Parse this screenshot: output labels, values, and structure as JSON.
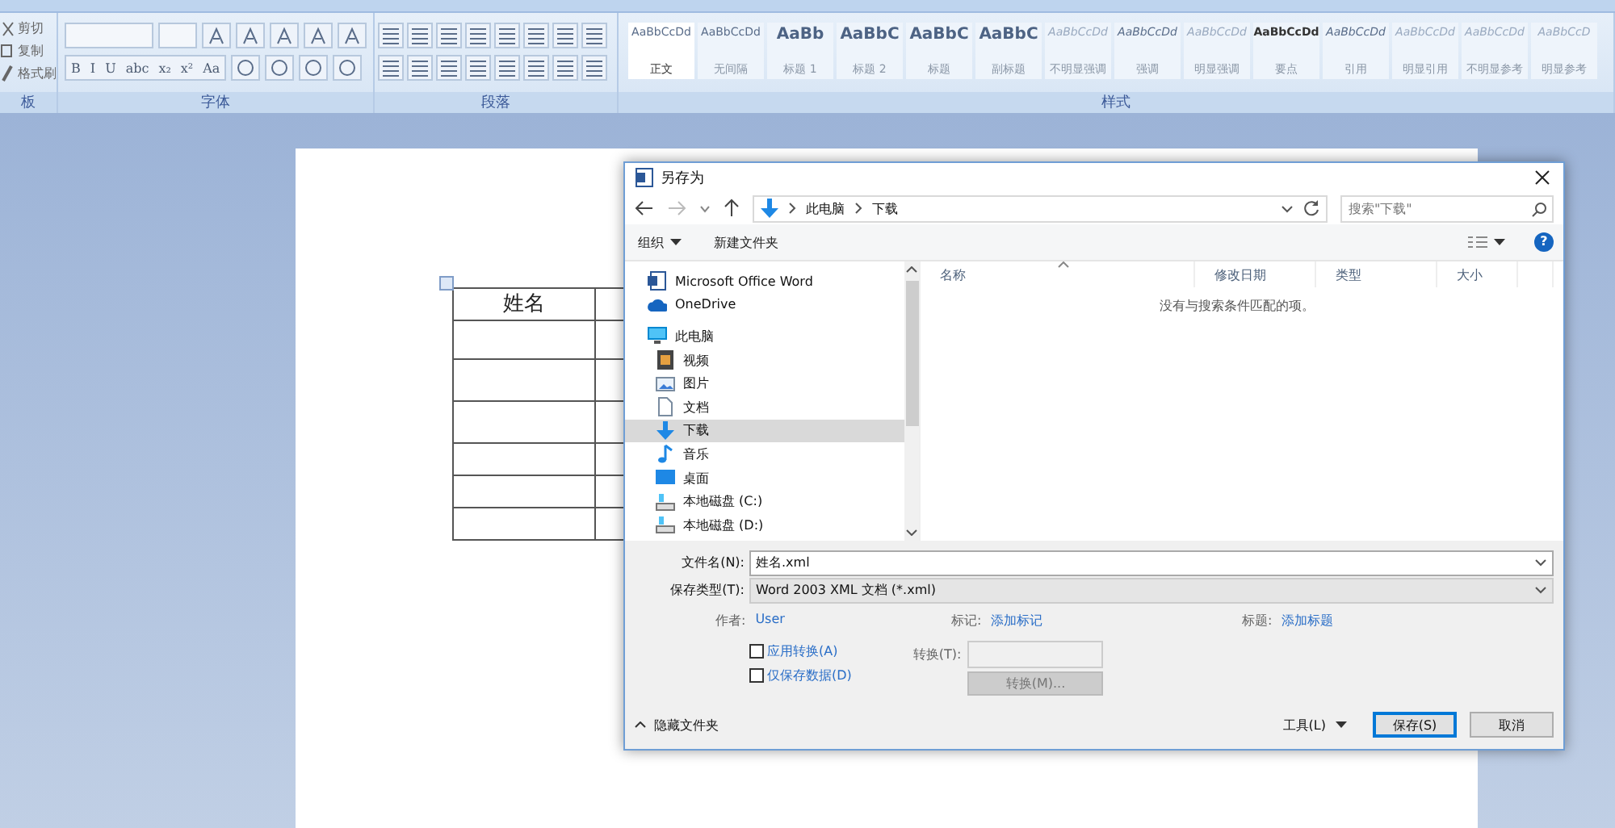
{
  "ribbon": {
    "clipboard": {
      "items": [
        {
          "kind": "cut",
          "label": "剪切"
        },
        {
          "kind": "copy",
          "label": "复制"
        },
        {
          "kind": "brush",
          "label": "格式刷"
        }
      ],
      "group_label": "板"
    },
    "font": {
      "format_buttons": [
        "B",
        "I",
        "U",
        "abc",
        "x₂",
        "x²",
        "Aa"
      ],
      "group_label": "字体"
    },
    "paragraph": {
      "group_label": "段落"
    },
    "styles": {
      "items": [
        {
          "preview": "AaBbCcDd",
          "label": "正文",
          "kind": "normal",
          "selected": true
        },
        {
          "preview": "AaBbCcDd",
          "label": "无间隔",
          "kind": "normal",
          "selected": false
        },
        {
          "preview": "AaBb",
          "label": "标题 1",
          "kind": "heading",
          "selected": false
        },
        {
          "preview": "AaBbC",
          "label": "标题 2",
          "kind": "heading",
          "selected": false
        },
        {
          "preview": "AaBbC",
          "label": "标题",
          "kind": "heading",
          "selected": false
        },
        {
          "preview": "AaBbC",
          "label": "副标题",
          "kind": "heading",
          "selected": false
        },
        {
          "preview": "AaBbCcDd",
          "label": "不明显强调",
          "kind": "faint",
          "selected": false
        },
        {
          "preview": "AaBbCcDd",
          "label": "强调",
          "kind": "italic",
          "selected": false
        },
        {
          "preview": "AaBbCcDd",
          "label": "明显强调",
          "kind": "faint",
          "selected": false
        },
        {
          "preview": "AaBbCcDd",
          "label": "要点",
          "kind": "bold",
          "selected": false
        },
        {
          "preview": "AaBbCcDd",
          "label": "引用",
          "kind": "italic",
          "selected": false
        },
        {
          "preview": "AaBbCcDd",
          "label": "明显引用",
          "kind": "faint",
          "selected": false
        },
        {
          "preview": "AaBbCcDd",
          "label": "不明显参考",
          "kind": "faint",
          "selected": false
        },
        {
          "preview": "AaBbCcD",
          "label": "明显参考",
          "kind": "faint",
          "selected": false
        }
      ],
      "group_label": "样式"
    }
  },
  "document": {
    "table": {
      "header": "姓名"
    }
  },
  "dialog": {
    "title": "另存为",
    "path": [
      "此电脑",
      "下载"
    ],
    "search_placeholder": "搜索\"下载\"",
    "toolbar": {
      "organize": "组织",
      "new_folder": "新建文件夹",
      "help": "?"
    },
    "nav_items": [
      {
        "kind": "word",
        "label": "Microsoft Office Word",
        "selected": false
      },
      {
        "kind": "cloud",
        "label": "OneDrive",
        "selected": false
      },
      {
        "kind": "pc",
        "label": "此电脑",
        "selected": false,
        "children": [
          {
            "kind": "video",
            "label": "视频",
            "selected": false
          },
          {
            "kind": "picture",
            "label": "图片",
            "selected": false
          },
          {
            "kind": "doc",
            "label": "文档",
            "selected": false
          },
          {
            "kind": "download",
            "label": "下载",
            "selected": true
          },
          {
            "kind": "music",
            "label": "音乐",
            "selected": false
          },
          {
            "kind": "desktop",
            "label": "桌面",
            "selected": false
          },
          {
            "kind": "drive",
            "label": "本地磁盘 (C:)",
            "selected": false
          },
          {
            "kind": "drive",
            "label": "本地磁盘 (D:)",
            "selected": false
          }
        ]
      }
    ],
    "columns": [
      "名称",
      "修改日期",
      "类型",
      "大小"
    ],
    "empty_message": "没有与搜索条件匹配的项。",
    "file_name": {
      "label": "文件名(N):",
      "value": "姓名.xml"
    },
    "save_type": {
      "label": "保存类型(T):",
      "value": "Word 2003 XML 文档 (*.xml)"
    },
    "meta": [
      {
        "label": "作者:",
        "value": "User"
      },
      {
        "label": "标记:",
        "value": "添加标记"
      },
      {
        "label": "标题:",
        "value": "添加标题"
      }
    ],
    "options": [
      {
        "label": "应用转换(A)",
        "checked": false
      },
      {
        "label": "仅保存数据(D)",
        "checked": false
      }
    ],
    "transform": {
      "label": "转换(T):",
      "button": "转换(M)...",
      "disabled": true
    },
    "hide_folders": "隐藏文件夹",
    "buttons": [
      {
        "kind": "tools",
        "label": "工具(L)"
      },
      {
        "kind": "primary",
        "label": "保存(S)"
      },
      {
        "kind": "normal",
        "label": "取消"
      }
    ]
  }
}
